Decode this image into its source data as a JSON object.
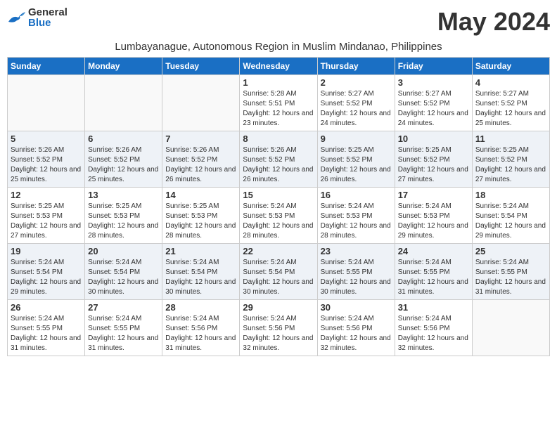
{
  "logo": {
    "general": "General",
    "blue": "Blue"
  },
  "title": "May 2024",
  "location": "Lumbayanague, Autonomous Region in Muslim Mindanao, Philippines",
  "weekdays": [
    "Sunday",
    "Monday",
    "Tuesday",
    "Wednesday",
    "Thursday",
    "Friday",
    "Saturday"
  ],
  "weeks": [
    [
      {
        "day": "",
        "sunrise": "",
        "sunset": "",
        "daylight": ""
      },
      {
        "day": "",
        "sunrise": "",
        "sunset": "",
        "daylight": ""
      },
      {
        "day": "",
        "sunrise": "",
        "sunset": "",
        "daylight": ""
      },
      {
        "day": "1",
        "sunrise": "Sunrise: 5:28 AM",
        "sunset": "Sunset: 5:51 PM",
        "daylight": "Daylight: 12 hours and 23 minutes."
      },
      {
        "day": "2",
        "sunrise": "Sunrise: 5:27 AM",
        "sunset": "Sunset: 5:52 PM",
        "daylight": "Daylight: 12 hours and 24 minutes."
      },
      {
        "day": "3",
        "sunrise": "Sunrise: 5:27 AM",
        "sunset": "Sunset: 5:52 PM",
        "daylight": "Daylight: 12 hours and 24 minutes."
      },
      {
        "day": "4",
        "sunrise": "Sunrise: 5:27 AM",
        "sunset": "Sunset: 5:52 PM",
        "daylight": "Daylight: 12 hours and 25 minutes."
      }
    ],
    [
      {
        "day": "5",
        "sunrise": "Sunrise: 5:26 AM",
        "sunset": "Sunset: 5:52 PM",
        "daylight": "Daylight: 12 hours and 25 minutes."
      },
      {
        "day": "6",
        "sunrise": "Sunrise: 5:26 AM",
        "sunset": "Sunset: 5:52 PM",
        "daylight": "Daylight: 12 hours and 25 minutes."
      },
      {
        "day": "7",
        "sunrise": "Sunrise: 5:26 AM",
        "sunset": "Sunset: 5:52 PM",
        "daylight": "Daylight: 12 hours and 26 minutes."
      },
      {
        "day": "8",
        "sunrise": "Sunrise: 5:26 AM",
        "sunset": "Sunset: 5:52 PM",
        "daylight": "Daylight: 12 hours and 26 minutes."
      },
      {
        "day": "9",
        "sunrise": "Sunrise: 5:25 AM",
        "sunset": "Sunset: 5:52 PM",
        "daylight": "Daylight: 12 hours and 26 minutes."
      },
      {
        "day": "10",
        "sunrise": "Sunrise: 5:25 AM",
        "sunset": "Sunset: 5:52 PM",
        "daylight": "Daylight: 12 hours and 27 minutes."
      },
      {
        "day": "11",
        "sunrise": "Sunrise: 5:25 AM",
        "sunset": "Sunset: 5:52 PM",
        "daylight": "Daylight: 12 hours and 27 minutes."
      }
    ],
    [
      {
        "day": "12",
        "sunrise": "Sunrise: 5:25 AM",
        "sunset": "Sunset: 5:53 PM",
        "daylight": "Daylight: 12 hours and 27 minutes."
      },
      {
        "day": "13",
        "sunrise": "Sunrise: 5:25 AM",
        "sunset": "Sunset: 5:53 PM",
        "daylight": "Daylight: 12 hours and 28 minutes."
      },
      {
        "day": "14",
        "sunrise": "Sunrise: 5:25 AM",
        "sunset": "Sunset: 5:53 PM",
        "daylight": "Daylight: 12 hours and 28 minutes."
      },
      {
        "day": "15",
        "sunrise": "Sunrise: 5:24 AM",
        "sunset": "Sunset: 5:53 PM",
        "daylight": "Daylight: 12 hours and 28 minutes."
      },
      {
        "day": "16",
        "sunrise": "Sunrise: 5:24 AM",
        "sunset": "Sunset: 5:53 PM",
        "daylight": "Daylight: 12 hours and 28 minutes."
      },
      {
        "day": "17",
        "sunrise": "Sunrise: 5:24 AM",
        "sunset": "Sunset: 5:53 PM",
        "daylight": "Daylight: 12 hours and 29 minutes."
      },
      {
        "day": "18",
        "sunrise": "Sunrise: 5:24 AM",
        "sunset": "Sunset: 5:54 PM",
        "daylight": "Daylight: 12 hours and 29 minutes."
      }
    ],
    [
      {
        "day": "19",
        "sunrise": "Sunrise: 5:24 AM",
        "sunset": "Sunset: 5:54 PM",
        "daylight": "Daylight: 12 hours and 29 minutes."
      },
      {
        "day": "20",
        "sunrise": "Sunrise: 5:24 AM",
        "sunset": "Sunset: 5:54 PM",
        "daylight": "Daylight: 12 hours and 30 minutes."
      },
      {
        "day": "21",
        "sunrise": "Sunrise: 5:24 AM",
        "sunset": "Sunset: 5:54 PM",
        "daylight": "Daylight: 12 hours and 30 minutes."
      },
      {
        "day": "22",
        "sunrise": "Sunrise: 5:24 AM",
        "sunset": "Sunset: 5:54 PM",
        "daylight": "Daylight: 12 hours and 30 minutes."
      },
      {
        "day": "23",
        "sunrise": "Sunrise: 5:24 AM",
        "sunset": "Sunset: 5:55 PM",
        "daylight": "Daylight: 12 hours and 30 minutes."
      },
      {
        "day": "24",
        "sunrise": "Sunrise: 5:24 AM",
        "sunset": "Sunset: 5:55 PM",
        "daylight": "Daylight: 12 hours and 31 minutes."
      },
      {
        "day": "25",
        "sunrise": "Sunrise: 5:24 AM",
        "sunset": "Sunset: 5:55 PM",
        "daylight": "Daylight: 12 hours and 31 minutes."
      }
    ],
    [
      {
        "day": "26",
        "sunrise": "Sunrise: 5:24 AM",
        "sunset": "Sunset: 5:55 PM",
        "daylight": "Daylight: 12 hours and 31 minutes."
      },
      {
        "day": "27",
        "sunrise": "Sunrise: 5:24 AM",
        "sunset": "Sunset: 5:55 PM",
        "daylight": "Daylight: 12 hours and 31 minutes."
      },
      {
        "day": "28",
        "sunrise": "Sunrise: 5:24 AM",
        "sunset": "Sunset: 5:56 PM",
        "daylight": "Daylight: 12 hours and 31 minutes."
      },
      {
        "day": "29",
        "sunrise": "Sunrise: 5:24 AM",
        "sunset": "Sunset: 5:56 PM",
        "daylight": "Daylight: 12 hours and 32 minutes."
      },
      {
        "day": "30",
        "sunrise": "Sunrise: 5:24 AM",
        "sunset": "Sunset: 5:56 PM",
        "daylight": "Daylight: 12 hours and 32 minutes."
      },
      {
        "day": "31",
        "sunrise": "Sunrise: 5:24 AM",
        "sunset": "Sunset: 5:56 PM",
        "daylight": "Daylight: 12 hours and 32 minutes."
      },
      {
        "day": "",
        "sunrise": "",
        "sunset": "",
        "daylight": ""
      }
    ]
  ]
}
